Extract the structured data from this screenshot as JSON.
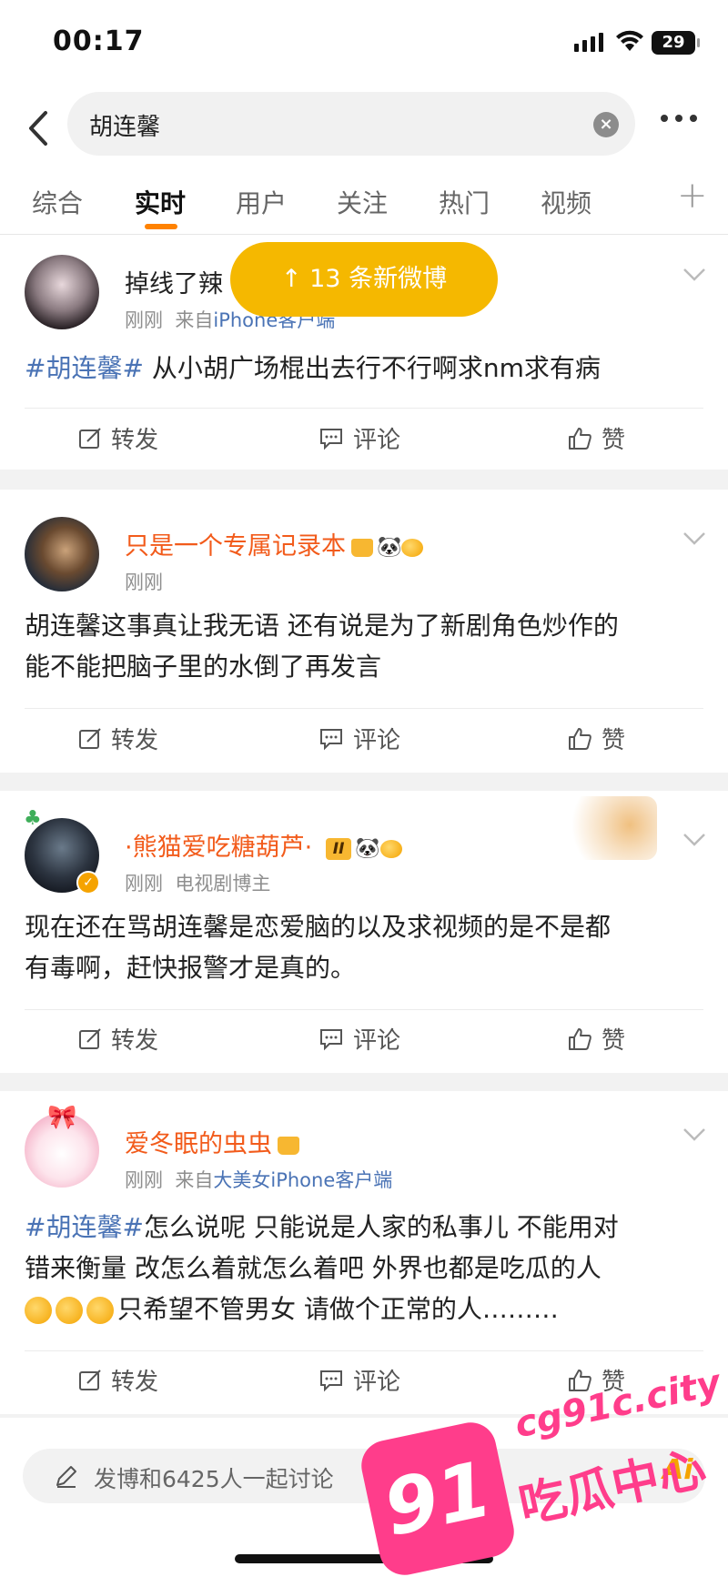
{
  "status_bar": {
    "time": "00:17",
    "battery": "29",
    "icons": [
      "signal-icon",
      "wifi-icon",
      "battery-icon"
    ]
  },
  "header": {
    "search_query": "胡连馨",
    "back_icon": "chevron-left-icon",
    "clear_icon": "clear-icon",
    "more_icon": "more-dots-icon"
  },
  "tabs": [
    {
      "label": "综合",
      "active": false
    },
    {
      "label": "实时",
      "active": true
    },
    {
      "label": "用户",
      "active": false
    },
    {
      "label": "关注",
      "active": false
    },
    {
      "label": "热门",
      "active": false
    },
    {
      "label": "视频",
      "active": false
    }
  ],
  "tabs_add": "+",
  "new_posts_pill": "↑ 13 条新微博",
  "actions": {
    "repost": "转发",
    "comment": "评论",
    "like": "赞"
  },
  "posts": [
    {
      "username": "掉线了辣",
      "time": "刚刚",
      "source_prefix": "来自",
      "source": "iPhone客户端",
      "hashtag": "#胡连馨#",
      "text": " 从小胡广场棍出去行不行啊求nm求有病"
    },
    {
      "username": "只是一个专属记录本",
      "badges": "🐼",
      "time": "刚刚",
      "text_line1": "胡连馨这事真让我无语 还有说是为了新剧角色炒作的",
      "text_line2": "能不能把脑子里的水倒了再发言"
    },
    {
      "username": "·熊猫爱吃糖葫芦·",
      "vip_level": "II",
      "badges": "🐼",
      "time": "刚刚",
      "title": "电视剧博主",
      "text_line1": "现在还在骂胡连馨是恋爱脑的以及求视频的是不是都",
      "text_line2": "有毒啊，赶快报警才是真的。"
    },
    {
      "username": "爱冬眠的虫虫",
      "time": "刚刚",
      "source_prefix": "来自",
      "source": "大美女iPhone客户端",
      "hashtag": "#胡连馨#",
      "text_line1": "怎么说呢 只能说是人家的私事儿 不能用对",
      "text_line2": "错来衡量 改怎么着就怎么着吧 外界也都是吃瓜的人",
      "text_line3": "只希望不管男女 请做个正常的人………"
    }
  ],
  "composer": {
    "text": "发博和6425人一起讨论",
    "ai_label": "Ai"
  },
  "watermark": {
    "number": "91",
    "site": "cg91c.city",
    "name": "吃瓜中心"
  },
  "colors": {
    "accent": "#ff8200",
    "link": "#4a73b5",
    "pill": "#f5b800",
    "watermark": "#ff3d8b"
  }
}
